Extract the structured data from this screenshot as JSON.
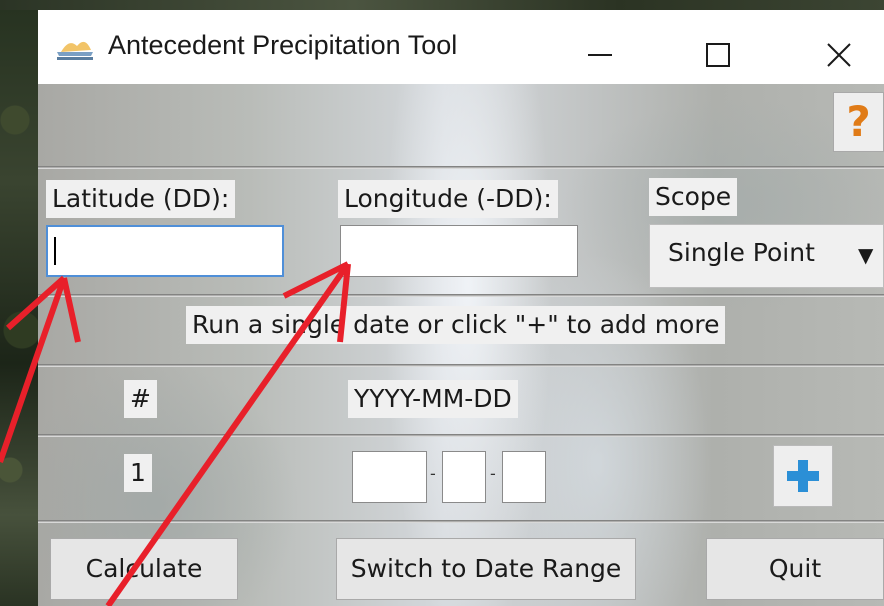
{
  "window": {
    "title": "Antecedent Precipitation Tool",
    "icon": "app-logo-icon",
    "controls": [
      "minimize-icon",
      "maximize-icon",
      "close-icon"
    ]
  },
  "help": {
    "label": "?"
  },
  "latitude": {
    "label": "Latitude (DD):",
    "value": ""
  },
  "longitude": {
    "label": "Longitude (-DD):",
    "value": ""
  },
  "scope": {
    "label": "Scope",
    "selected": "Single Point"
  },
  "instruction": "Run a single date or click \"+\" to add more",
  "dates_table": {
    "col_number": "#",
    "col_date": "YYYY-MM-DD",
    "rows": [
      {
        "number": "1",
        "year": "",
        "month": "",
        "day": ""
      }
    ]
  },
  "buttons": {
    "calculate": "Calculate",
    "switch": "Switch to Date Range",
    "quit": "Quit"
  },
  "colors": {
    "accent": "#2b8fd6",
    "help": "#e07b17",
    "annotation": "#e8202a"
  }
}
